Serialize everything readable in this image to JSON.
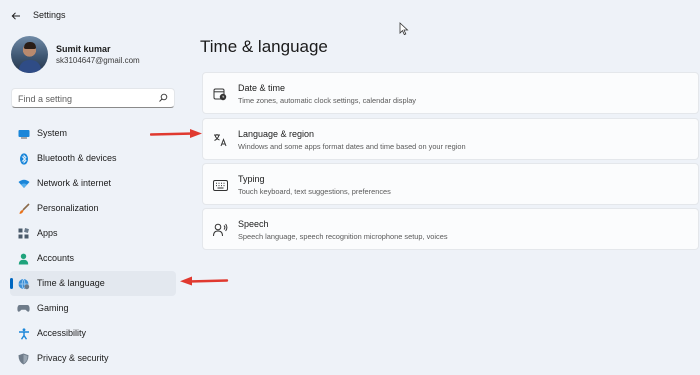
{
  "window": {
    "title": "Settings"
  },
  "profile": {
    "name": "Sumit kumar",
    "email": "sk3104647@gmail.com"
  },
  "search": {
    "placeholder": "Find a setting"
  },
  "sidebar": {
    "items": [
      {
        "label": "System",
        "icon": "monitor-icon",
        "selected": false
      },
      {
        "label": "Bluetooth & devices",
        "icon": "bluetooth-icon",
        "selected": false
      },
      {
        "label": "Network & internet",
        "icon": "wifi-icon",
        "selected": false
      },
      {
        "label": "Personalization",
        "icon": "brush-icon",
        "selected": false
      },
      {
        "label": "Apps",
        "icon": "apps-icon",
        "selected": false
      },
      {
        "label": "Accounts",
        "icon": "person-icon",
        "selected": false
      },
      {
        "label": "Time & language",
        "icon": "globe-clock-icon",
        "selected": true
      },
      {
        "label": "Gaming",
        "icon": "gamepad-icon",
        "selected": false
      },
      {
        "label": "Accessibility",
        "icon": "accessibility-icon",
        "selected": false
      },
      {
        "label": "Privacy & security",
        "icon": "shield-icon",
        "selected": false
      }
    ]
  },
  "main": {
    "title": "Time & language",
    "cards": [
      {
        "title": "Date & time",
        "description": "Time zones, automatic clock settings, calendar display",
        "icon": "calendar-clock-icon"
      },
      {
        "title": "Language & region",
        "description": "Windows and some apps format dates and time based on your region",
        "icon": "language-icon"
      },
      {
        "title": "Typing",
        "description": "Touch keyboard, text suggestions, preferences",
        "icon": "keyboard-icon"
      },
      {
        "title": "Speech",
        "description": "Speech language, speech recognition microphone setup, voices",
        "icon": "speech-icon"
      }
    ]
  },
  "colors": {
    "accent": "#0067c0",
    "annotation_arrow": "#e0392f",
    "background": "#eef2f8"
  }
}
